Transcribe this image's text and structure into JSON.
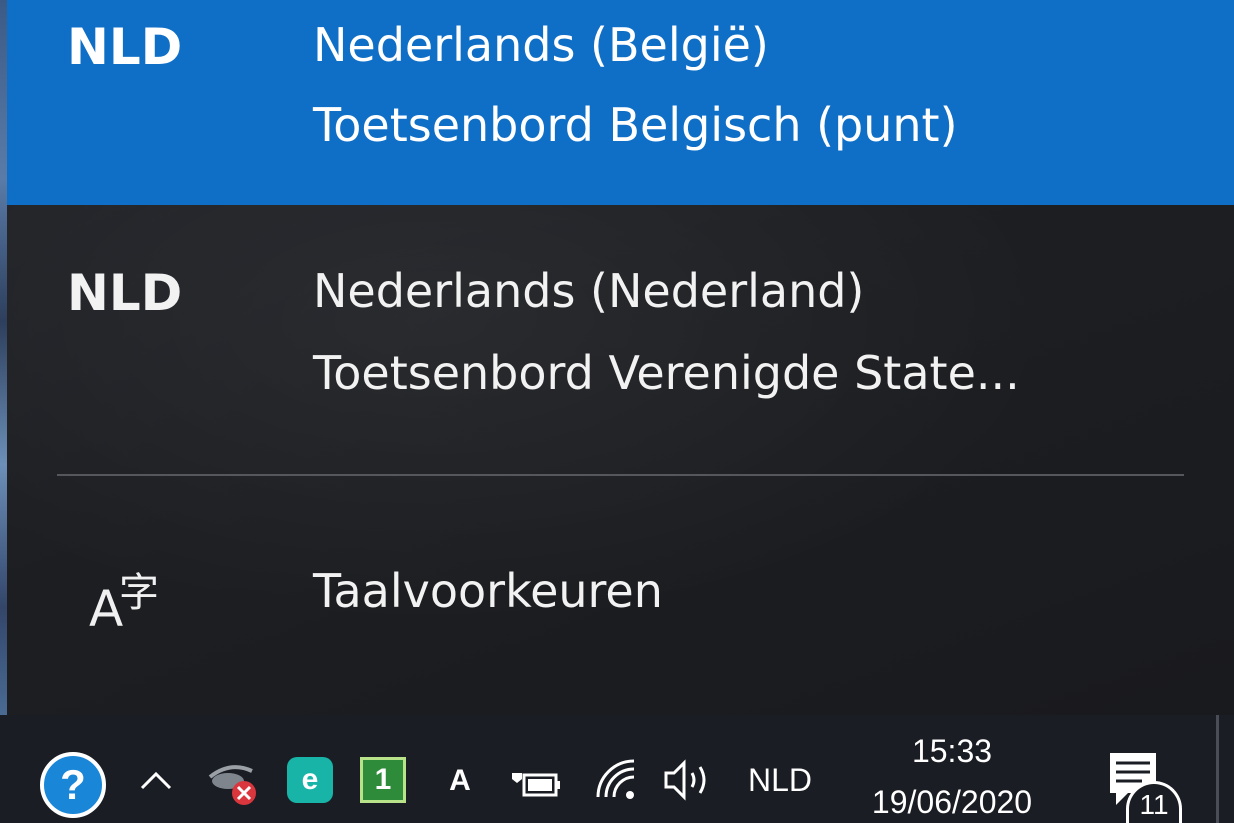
{
  "languages": [
    {
      "code": "NLD",
      "language": "Nederlands (België)",
      "keyboard": "Toetsenbord Belgisch (punt)",
      "selected": true
    },
    {
      "code": "NLD",
      "language": "Nederlands (Nederland)",
      "keyboard": "Toetsenbord Verenigde State...",
      "selected": false
    }
  ],
  "preferences": {
    "label": "Taalvoorkeuren",
    "icon": "language-preferences-icon",
    "icon_glyph_a": "A",
    "icon_glyph_zi": "字"
  },
  "colors": {
    "accent": "#0f6fc6",
    "flyout_bg": "#1f2125",
    "taskbar_bg": "#1a1d23"
  },
  "taskbar": {
    "help_glyph": "?",
    "eset_glyph": "e",
    "one_glyph": "1",
    "font_glyph": "A",
    "language": "NLD",
    "time": "15:33",
    "date": "19/06/2020",
    "notification_count": "11",
    "tray_icons": [
      "help-icon",
      "chevron-up-icon",
      "eye-icon",
      "eset-icon",
      "one-icon",
      "font-a-icon",
      "battery-icon",
      "wifi-icon",
      "volume-icon"
    ]
  }
}
